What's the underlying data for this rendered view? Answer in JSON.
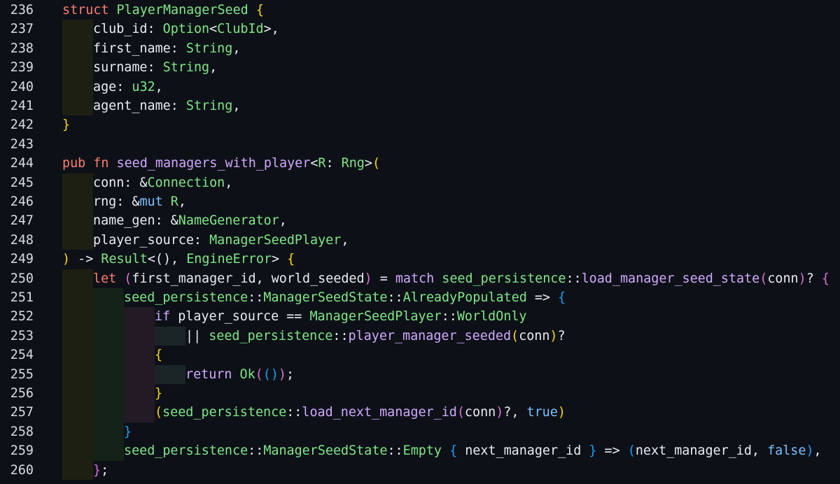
{
  "colors": {
    "background": "#0d1117",
    "line_number": "#d9dde3",
    "keyword": "#ff7b72",
    "type": "#7ee787",
    "function": "#d2a8ff",
    "plain": "#e6edf3",
    "literal": "#79c0ff",
    "bracket_1": "#ffd700",
    "bracket_2": "#da70d6",
    "bracket_3": "#179fff"
  },
  "lines": [
    {
      "num": "236",
      "indent": 0,
      "tokens": [
        {
          "t": "struct ",
          "c": "kw"
        },
        {
          "t": "PlayerManagerSeed ",
          "c": "ty"
        },
        {
          "t": "{",
          "c": "br1"
        }
      ]
    },
    {
      "num": "237",
      "indent": 1,
      "tokens": [
        {
          "t": "club_id: ",
          "c": "pl"
        },
        {
          "t": "Option",
          "c": "ty"
        },
        {
          "t": "<",
          "c": "pl"
        },
        {
          "t": "ClubId",
          "c": "ty"
        },
        {
          "t": ">,",
          "c": "pl"
        }
      ]
    },
    {
      "num": "238",
      "indent": 1,
      "tokens": [
        {
          "t": "first_name: ",
          "c": "pl"
        },
        {
          "t": "String",
          "c": "ty"
        },
        {
          "t": ",",
          "c": "pl"
        }
      ]
    },
    {
      "num": "239",
      "indent": 1,
      "tokens": [
        {
          "t": "surname: ",
          "c": "pl"
        },
        {
          "t": "String",
          "c": "ty"
        },
        {
          "t": ",",
          "c": "pl"
        }
      ]
    },
    {
      "num": "240",
      "indent": 1,
      "tokens": [
        {
          "t": "age: ",
          "c": "pl"
        },
        {
          "t": "u32",
          "c": "ty"
        },
        {
          "t": ",",
          "c": "pl"
        }
      ]
    },
    {
      "num": "241",
      "indent": 1,
      "tokens": [
        {
          "t": "agent_name: ",
          "c": "pl"
        },
        {
          "t": "String",
          "c": "ty"
        },
        {
          "t": ",",
          "c": "pl"
        }
      ]
    },
    {
      "num": "242",
      "indent": 0,
      "tokens": [
        {
          "t": "}",
          "c": "br1"
        }
      ]
    },
    {
      "num": "243",
      "indent": 0,
      "tokens": []
    },
    {
      "num": "244",
      "indent": 0,
      "tokens": [
        {
          "t": "pub ",
          "c": "kw"
        },
        {
          "t": "fn ",
          "c": "kw"
        },
        {
          "t": "seed_managers_with_player",
          "c": "fn"
        },
        {
          "t": "<",
          "c": "pl"
        },
        {
          "t": "R",
          "c": "ty"
        },
        {
          "t": ": ",
          "c": "pl"
        },
        {
          "t": "Rng",
          "c": "ty"
        },
        {
          "t": ">",
          "c": "pl"
        },
        {
          "t": "(",
          "c": "br1"
        }
      ]
    },
    {
      "num": "245",
      "indent": 1,
      "tokens": [
        {
          "t": "conn: &",
          "c": "pl"
        },
        {
          "t": "Connection",
          "c": "ty"
        },
        {
          "t": ",",
          "c": "pl"
        }
      ]
    },
    {
      "num": "246",
      "indent": 1,
      "tokens": [
        {
          "t": "rng: &",
          "c": "pl"
        },
        {
          "t": "mut ",
          "c": "ln2"
        },
        {
          "t": "R",
          "c": "ty"
        },
        {
          "t": ",",
          "c": "pl"
        }
      ]
    },
    {
      "num": "247",
      "indent": 1,
      "tokens": [
        {
          "t": "name_gen: &",
          "c": "pl"
        },
        {
          "t": "NameGenerator",
          "c": "ty"
        },
        {
          "t": ",",
          "c": "pl"
        }
      ]
    },
    {
      "num": "248",
      "indent": 1,
      "tokens": [
        {
          "t": "player_source: ",
          "c": "pl"
        },
        {
          "t": "ManagerSeedPlayer",
          "c": "ty"
        },
        {
          "t": ",",
          "c": "pl"
        }
      ]
    },
    {
      "num": "249",
      "indent": 0,
      "tokens": [
        {
          "t": ")",
          "c": "br1"
        },
        {
          "t": " -> ",
          "c": "pl"
        },
        {
          "t": "Result",
          "c": "ty"
        },
        {
          "t": "<",
          "c": "pl"
        },
        {
          "t": "()",
          "c": "pl"
        },
        {
          "t": ", ",
          "c": "pl"
        },
        {
          "t": "EngineError",
          "c": "ty"
        },
        {
          "t": "> ",
          "c": "pl"
        },
        {
          "t": "{",
          "c": "br1"
        }
      ]
    },
    {
      "num": "250",
      "indent": 1,
      "tokens": [
        {
          "t": "let ",
          "c": "kw"
        },
        {
          "t": "(",
          "c": "br2"
        },
        {
          "t": "first_manager_id, world_seeded",
          "c": "pl"
        },
        {
          "t": ")",
          "c": "br2"
        },
        {
          "t": " = ",
          "c": "pl"
        },
        {
          "t": "match ",
          "c": "fn"
        },
        {
          "t": "seed_persistence",
          "c": "ty"
        },
        {
          "t": "::",
          "c": "pl"
        },
        {
          "t": "load_manager_seed_state",
          "c": "fn"
        },
        {
          "t": "(",
          "c": "br2"
        },
        {
          "t": "conn",
          "c": "pl"
        },
        {
          "t": ")",
          "c": "br2"
        },
        {
          "t": "? ",
          "c": "pl"
        },
        {
          "t": "{",
          "c": "br2"
        }
      ]
    },
    {
      "num": "251",
      "indent": 2,
      "tokens": [
        {
          "t": "seed_persistence",
          "c": "ty"
        },
        {
          "t": "::",
          "c": "pl"
        },
        {
          "t": "ManagerSeedState",
          "c": "ty"
        },
        {
          "t": "::",
          "c": "pl"
        },
        {
          "t": "AlreadyPopulated",
          "c": "ty"
        },
        {
          "t": " => ",
          "c": "pl"
        },
        {
          "t": "{",
          "c": "br3"
        }
      ]
    },
    {
      "num": "252",
      "indent": 3,
      "tokens": [
        {
          "t": "if ",
          "c": "fn"
        },
        {
          "t": "player_source == ",
          "c": "pl"
        },
        {
          "t": "ManagerSeedPlayer",
          "c": "ty"
        },
        {
          "t": "::",
          "c": "pl"
        },
        {
          "t": "WorldOnly",
          "c": "ty"
        }
      ]
    },
    {
      "num": "253",
      "indent": 4,
      "tokens": [
        {
          "t": "|| ",
          "c": "pl"
        },
        {
          "t": "seed_persistence",
          "c": "ty"
        },
        {
          "t": "::",
          "c": "pl"
        },
        {
          "t": "player_manager_seeded",
          "c": "fn"
        },
        {
          "t": "(",
          "c": "br1"
        },
        {
          "t": "conn",
          "c": "pl"
        },
        {
          "t": ")",
          "c": "br1"
        },
        {
          "t": "?",
          "c": "pl"
        }
      ]
    },
    {
      "num": "254",
      "indent": 3,
      "tokens": [
        {
          "t": "{",
          "c": "br1"
        }
      ]
    },
    {
      "num": "255",
      "indent": 4,
      "tokens": [
        {
          "t": "return ",
          "c": "fn"
        },
        {
          "t": "Ok",
          "c": "ty"
        },
        {
          "t": "(",
          "c": "br2"
        },
        {
          "t": "()",
          "c": "br3"
        },
        {
          "t": ")",
          "c": "br2"
        },
        {
          "t": ";",
          "c": "pl"
        }
      ]
    },
    {
      "num": "256",
      "indent": 3,
      "tokens": [
        {
          "t": "}",
          "c": "br1"
        }
      ]
    },
    {
      "num": "257",
      "indent": 3,
      "tokens": [
        {
          "t": "(",
          "c": "br1"
        },
        {
          "t": "seed_persistence",
          "c": "ty"
        },
        {
          "t": "::",
          "c": "pl"
        },
        {
          "t": "load_next_manager_id",
          "c": "fn"
        },
        {
          "t": "(",
          "c": "br2"
        },
        {
          "t": "conn",
          "c": "pl"
        },
        {
          "t": ")",
          "c": "br2"
        },
        {
          "t": "?, ",
          "c": "pl"
        },
        {
          "t": "true",
          "c": "ln2"
        },
        {
          "t": ")",
          "c": "br1"
        }
      ]
    },
    {
      "num": "258",
      "indent": 2,
      "tokens": [
        {
          "t": "}",
          "c": "br3"
        }
      ]
    },
    {
      "num": "259",
      "indent": 2,
      "tokens": [
        {
          "t": "seed_persistence",
          "c": "ty"
        },
        {
          "t": "::",
          "c": "pl"
        },
        {
          "t": "ManagerSeedState",
          "c": "ty"
        },
        {
          "t": "::",
          "c": "pl"
        },
        {
          "t": "Empty ",
          "c": "ty"
        },
        {
          "t": "{",
          "c": "br3"
        },
        {
          "t": " next_manager_id ",
          "c": "pl"
        },
        {
          "t": "}",
          "c": "br3"
        },
        {
          "t": " => ",
          "c": "pl"
        },
        {
          "t": "(",
          "c": "br3"
        },
        {
          "t": "next_manager_id, ",
          "c": "pl"
        },
        {
          "t": "false",
          "c": "ln2"
        },
        {
          "t": ")",
          "c": "br3"
        },
        {
          "t": ",",
          "c": "pl"
        }
      ]
    },
    {
      "num": "260",
      "indent": 1,
      "tokens": [
        {
          "t": "}",
          "c": "br2"
        },
        {
          "t": ";",
          "c": "pl"
        }
      ]
    }
  ]
}
